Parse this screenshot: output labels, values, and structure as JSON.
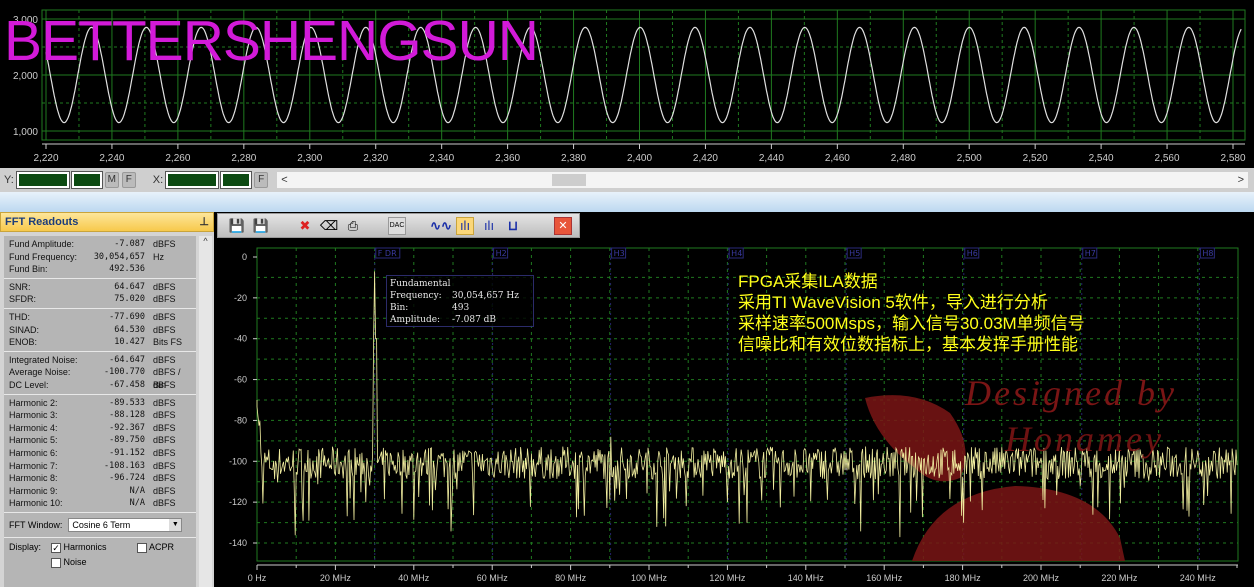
{
  "brand": "BETTERSHENGSUN",
  "time_plot": {
    "y_ticks": [
      "3,000",
      "2,000",
      "1,000"
    ],
    "y_values": [
      3000,
      2000,
      1000
    ],
    "x_ticks": [
      "2,220",
      "2,240",
      "2,260",
      "2,280",
      "2,300",
      "2,320",
      "2,340",
      "2,360",
      "2,380",
      "2,400",
      "2,420",
      "2,440",
      "2,460",
      "2,480",
      "2,500",
      "2,520",
      "2,540",
      "2,560",
      "2,580"
    ],
    "signal_min": 1150,
    "signal_max": 2850,
    "period_samples": 16.64,
    "trace_color": "#e0e0e0",
    "grid_color": "#1f7a1f"
  },
  "controls": {
    "y_label": "Y:",
    "x_label": "X:",
    "m_btn": "M",
    "f_btn": "F",
    "f_btn2": "F",
    "scroll_left": "<",
    "scroll_right": ">"
  },
  "readouts": {
    "title": "FFT Readouts",
    "pin": "⊥",
    "groups": [
      [
        {
          "k": "Fund Amplitude:",
          "v": "-7.087",
          "u": "dBFS"
        },
        {
          "k": "Fund Frequency:",
          "v": "30,054,657",
          "u": "Hz"
        },
        {
          "k": "Fund Bin:",
          "v": "492.536",
          "u": ""
        }
      ],
      [
        {
          "k": "SNR:",
          "v": "64.647",
          "u": "dBFS"
        },
        {
          "k": "SFDR:",
          "v": "75.020",
          "u": "dBFS"
        }
      ],
      [
        {
          "k": "THD:",
          "v": "-77.690",
          "u": "dBFS"
        },
        {
          "k": "SINAD:",
          "v": "64.530",
          "u": "dBFS"
        },
        {
          "k": "ENOB:",
          "v": "10.427",
          "u": "Bits FS"
        }
      ],
      [
        {
          "k": "Integrated Noise:",
          "v": "-64.647",
          "u": "dBFS"
        },
        {
          "k": "Average Noise:",
          "v": "-100.770",
          "u": "dBFS / Bin"
        },
        {
          "k": "DC Level:",
          "v": "-67.458",
          "u": "dBFS"
        }
      ],
      [
        {
          "k": "Harmonic 2:",
          "v": "-89.533",
          "u": "dBFS"
        },
        {
          "k": "Harmonic 3:",
          "v": "-88.128",
          "u": "dBFS"
        },
        {
          "k": "Harmonic 4:",
          "v": "-92.367",
          "u": "dBFS"
        },
        {
          "k": "Harmonic 5:",
          "v": "-89.750",
          "u": "dBFS"
        },
        {
          "k": "Harmonic 6:",
          "v": "-91.152",
          "u": "dBFS"
        },
        {
          "k": "Harmonic 7:",
          "v": "-108.163",
          "u": "dBFS"
        },
        {
          "k": "Harmonic 8:",
          "v": "-96.724",
          "u": "dBFS"
        },
        {
          "k": "Harmonic 9:",
          "v": "N/A",
          "u": "dBFS"
        },
        {
          "k": "Harmonic 10:",
          "v": "N/A",
          "u": "dBFS"
        }
      ]
    ],
    "fft_window_label": "FFT Window:",
    "fft_window_value": "Cosine 6 Term",
    "display_label": "Display:",
    "harmonics": "Harmonics",
    "harmonics_checked": true,
    "acpr": "ACPR",
    "acpr_checked": false,
    "noise": "Noise",
    "noise_checked": false
  },
  "toolbar": {
    "icons": [
      "save-icon",
      "save-as-icon",
      "clear-marker-icon",
      "eraser-icon",
      "print-icon",
      "dac-icon",
      "time-domain-icon",
      "fft-icon",
      "fft-alt-icon",
      "window-icon",
      "close-icon"
    ],
    "dac": "DAC",
    "close": "✕"
  },
  "fft": {
    "y_ticks": [
      "0",
      "-20",
      "-40",
      "-60",
      "-80",
      "-100",
      "-120",
      "-140"
    ],
    "y_values": [
      0,
      -20,
      -40,
      -60,
      -80,
      -100,
      -120,
      -140
    ],
    "x_ticks": [
      "0 Hz",
      "20 MHz",
      "40 MHz",
      "60 MHz",
      "80 MHz",
      "100 MHz",
      "120 MHz",
      "140 MHz",
      "160 MHz",
      "180 MHz",
      "200 MHz",
      "220 MHz",
      "240 MHz"
    ],
    "x_values": [
      0,
      20,
      40,
      60,
      80,
      100,
      120,
      140,
      160,
      180,
      200,
      220,
      240
    ],
    "xlim_mhz": [
      0,
      250
    ],
    "ylim_db": [
      -150,
      5
    ],
    "markers": [
      {
        "label": "F DR",
        "f": 30.05
      },
      {
        "label": "H2",
        "f": 60.1
      },
      {
        "label": "H3",
        "f": 90.2
      },
      {
        "label": "H4",
        "f": 120.2
      },
      {
        "label": "H5",
        "f": 150.3
      },
      {
        "label": "H6",
        "f": 180.3
      },
      {
        "label": "H7",
        "f": 210.4
      },
      {
        "label": "H8",
        "f": 240.4
      }
    ],
    "fundamental_mhz": 30.05,
    "fundamental_db": -7.087,
    "noise_floor_db": -100.77,
    "dc_db": -67.458,
    "trace_color": "#f2eea0",
    "grid_color": "#1f7a1f",
    "tooltip": {
      "title": "Fundamental",
      "rows": [
        {
          "k": "Frequency:",
          "v": "30,054,657 Hz"
        },
        {
          "k": "Bin:",
          "v": "493"
        },
        {
          "k": "Amplitude:",
          "v": "-7.087 dB"
        }
      ]
    }
  },
  "annotation": [
    "FPGA采集ILA数据",
    "采用TI WaveVision 5软件，导入进行分析",
    "采样速率500Msps，输入信号30.03M单频信号",
    "信噪比和有效位数指标上，基本发挥手册性能"
  ],
  "watermark": [
    "Designed by",
    "Honamey"
  ]
}
